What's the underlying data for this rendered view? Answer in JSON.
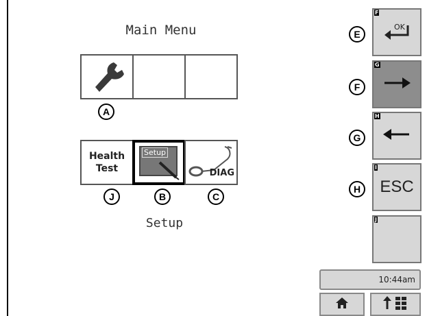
{
  "screen": {
    "title": "Main Menu",
    "selected_caption": "Setup"
  },
  "menu": {
    "top_row": [
      {
        "icon": "wrench-icon",
        "label": ""
      },
      {
        "label": ""
      },
      {
        "label": ""
      }
    ],
    "bottom_row": [
      {
        "label_line1": "Health",
        "label_line2": "Test"
      },
      {
        "label": "Setup",
        "selected": true
      },
      {
        "label": "DIAG",
        "icon": "stethoscope-icon"
      }
    ]
  },
  "callouts": {
    "a": "A",
    "j": "J",
    "b": "B",
    "c": "C",
    "e": "E",
    "f": "F",
    "g": "G",
    "h": "H"
  },
  "softkeys": [
    {
      "key": "F",
      "label": "OK",
      "icon": "enter-icon"
    },
    {
      "key": "G",
      "icon": "right-arrow-icon"
    },
    {
      "key": "H",
      "icon": "left-arrow-icon"
    },
    {
      "key": "I",
      "label": "ESC"
    },
    {
      "key": "J",
      "label": ""
    }
  ],
  "status": {
    "time": "10:44am"
  },
  "bottom_bar": {
    "home_icon": "home-icon",
    "nav_icon": "navigation-grid-icon"
  }
}
